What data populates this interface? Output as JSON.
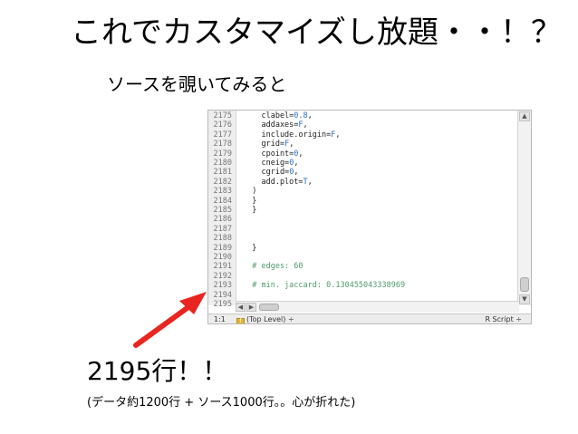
{
  "slide": {
    "title": "これでカスタマイズし放題・・！？",
    "subtitle": "ソースを覗いてみると",
    "big_count": "2195行！！",
    "note": "(データ約1200行 + ソース1000行。。心が折れた)",
    "arrow_color": "#e8251f"
  },
  "editor": {
    "lines": [
      {
        "no": "2175",
        "code": "    clabel=0.8,"
      },
      {
        "no": "2176",
        "code": "    addaxes=F,"
      },
      {
        "no": "2177",
        "code": "    include.origin=F,"
      },
      {
        "no": "2178",
        "code": "    grid=F,"
      },
      {
        "no": "2179",
        "code": "    cpoint=0,"
      },
      {
        "no": "2180",
        "code": "    cneig=0,"
      },
      {
        "no": "2181",
        "code": "    cgrid=0,"
      },
      {
        "no": "2182",
        "code": "    add.plot=T,"
      },
      {
        "no": "2183",
        "code": "  )"
      },
      {
        "no": "2184",
        "code": "  }"
      },
      {
        "no": "2185",
        "code": "  }"
      },
      {
        "no": "2186",
        "code": ""
      },
      {
        "no": "2187",
        "code": ""
      },
      {
        "no": "2188",
        "code": ""
      },
      {
        "no": "2189",
        "code": "  }"
      },
      {
        "no": "2190",
        "code": ""
      },
      {
        "no": "2191",
        "code": "  # edges: 60",
        "comment": true
      },
      {
        "no": "2192",
        "code": ""
      },
      {
        "no": "2193",
        "code": "  # min. jaccard: 0.130455043338969",
        "comment": true
      },
      {
        "no": "2194",
        "code": ""
      },
      {
        "no": "2195",
        "code": ""
      }
    ],
    "status": {
      "position": "1:1",
      "scope": "(Top Level) ÷",
      "file_type": "R Script ÷"
    }
  }
}
